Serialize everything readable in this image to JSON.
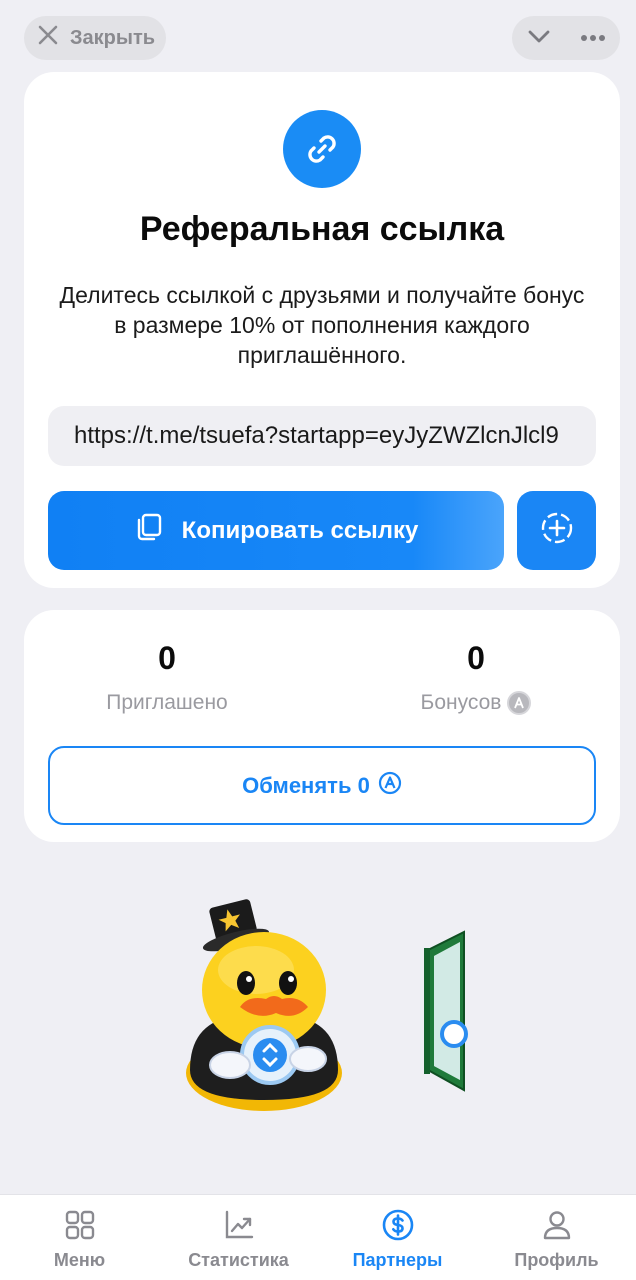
{
  "topbar": {
    "close_label": "Закрыть",
    "close_icon": "close-icon",
    "collapse_icon": "chevron-down-icon",
    "more_icon": "more-dots-icon"
  },
  "referral": {
    "title": "Реферальная ссылка",
    "description": "Делитесь ссылкой с друзьями и получайте бонус в размере 10% от пополнения каждого приглашённого.",
    "link": "https://t.me/tsuefa?startapp=eyJyZWZlcnJlcl9",
    "copy_label": "Копировать ссылку",
    "link_icon": "link-icon",
    "copy_icon": "copy-icon",
    "add_icon": "add-circle-icon"
  },
  "stats": {
    "invited_value": "0",
    "invited_label": "Приглашено",
    "bonus_value": "0",
    "bonus_label": "Бонусов",
    "exchange_label": "Обменять 0"
  },
  "nav": {
    "items": [
      {
        "label": "Меню",
        "icon": "grid-icon",
        "active": false
      },
      {
        "label": "Статистика",
        "icon": "chart-icon",
        "active": false
      },
      {
        "label": "Партнеры",
        "icon": "dollar-icon",
        "active": true
      },
      {
        "label": "Профиль",
        "icon": "profile-icon",
        "active": false
      }
    ]
  },
  "colors": {
    "accent": "#1a86f5",
    "background": "#efeff4",
    "muted": "#9a9aa0"
  }
}
